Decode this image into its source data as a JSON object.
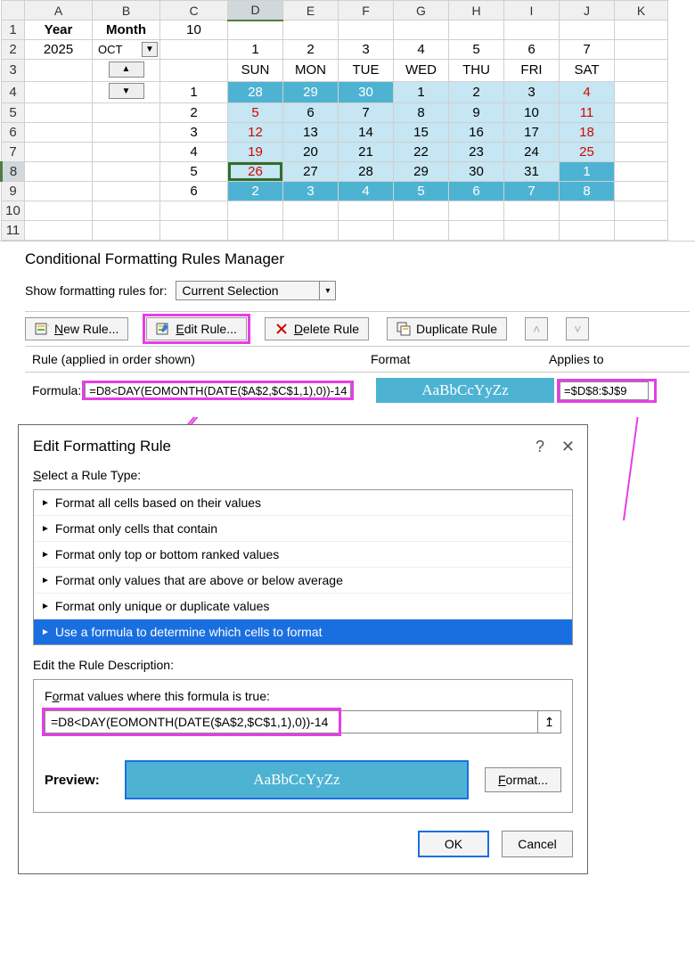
{
  "sheet": {
    "cols": [
      "A",
      "B",
      "C",
      "D",
      "E",
      "F",
      "G",
      "H",
      "I",
      "J",
      "K"
    ],
    "headers": {
      "year": "Year",
      "month": "Month"
    },
    "year_value": "2025",
    "month_value": "OCT",
    "c1_value": "10",
    "day_nums": [
      "1",
      "2",
      "3",
      "4",
      "5",
      "6",
      "7"
    ],
    "day_names": [
      "SUN",
      "MON",
      "TUE",
      "WED",
      "THU",
      "FRI",
      "SAT"
    ],
    "weeks": [
      {
        "n": "1",
        "cells": [
          {
            "v": "28",
            "c": "dark"
          },
          {
            "v": "29",
            "c": "dark"
          },
          {
            "v": "30",
            "c": "dark"
          },
          {
            "v": "1",
            "c": "light"
          },
          {
            "v": "2",
            "c": "light"
          },
          {
            "v": "3",
            "c": "light"
          },
          {
            "v": "4",
            "c": "light",
            "red": true
          }
        ]
      },
      {
        "n": "2",
        "cells": [
          {
            "v": "5",
            "c": "light",
            "red": true
          },
          {
            "v": "6",
            "c": "light"
          },
          {
            "v": "7",
            "c": "light"
          },
          {
            "v": "8",
            "c": "light"
          },
          {
            "v": "9",
            "c": "light"
          },
          {
            "v": "10",
            "c": "light"
          },
          {
            "v": "11",
            "c": "light",
            "red": true
          }
        ]
      },
      {
        "n": "3",
        "cells": [
          {
            "v": "12",
            "c": "light",
            "red": true
          },
          {
            "v": "13",
            "c": "light"
          },
          {
            "v": "14",
            "c": "light"
          },
          {
            "v": "15",
            "c": "light"
          },
          {
            "v": "16",
            "c": "light"
          },
          {
            "v": "17",
            "c": "light"
          },
          {
            "v": "18",
            "c": "light",
            "red": true
          }
        ]
      },
      {
        "n": "4",
        "cells": [
          {
            "v": "19",
            "c": "light",
            "red": true
          },
          {
            "v": "20",
            "c": "light"
          },
          {
            "v": "21",
            "c": "light"
          },
          {
            "v": "22",
            "c": "light"
          },
          {
            "v": "23",
            "c": "light"
          },
          {
            "v": "24",
            "c": "light"
          },
          {
            "v": "25",
            "c": "light",
            "red": true
          }
        ]
      },
      {
        "n": "5",
        "cells": [
          {
            "v": "26",
            "c": "light",
            "red": true,
            "active": true
          },
          {
            "v": "27",
            "c": "light"
          },
          {
            "v": "28",
            "c": "light"
          },
          {
            "v": "29",
            "c": "light"
          },
          {
            "v": "30",
            "c": "light"
          },
          {
            "v": "31",
            "c": "light"
          },
          {
            "v": "1",
            "c": "dark"
          }
        ]
      },
      {
        "n": "6",
        "cells": [
          {
            "v": "2",
            "c": "dark"
          },
          {
            "v": "3",
            "c": "dark"
          },
          {
            "v": "4",
            "c": "dark"
          },
          {
            "v": "5",
            "c": "dark"
          },
          {
            "v": "6",
            "c": "dark"
          },
          {
            "v": "7",
            "c": "dark"
          },
          {
            "v": "8",
            "c": "dark"
          }
        ]
      }
    ]
  },
  "manager": {
    "title": "Conditional Formatting Rules Manager",
    "show_for_label": "Show formatting rules for:",
    "show_for_value": "Current Selection",
    "buttons": {
      "new": "New Rule...",
      "edit": "Edit Rule...",
      "delete": "Delete Rule",
      "duplicate": "Duplicate Rule"
    },
    "cols": {
      "rule": "Rule (applied in order shown)",
      "format": "Format",
      "applies": "Applies to"
    },
    "row": {
      "label": "Formula:",
      "formula": "=D8<DAY(EOMONTH(DATE($A$2,$C$1,1),0))-14",
      "preview": "AaBbCcYyZz",
      "applies": "=$D$8:$J$9"
    }
  },
  "dialog": {
    "title": "Edit Formatting Rule",
    "select_label": "Select a Rule Type:",
    "types": [
      "Format all cells based on their values",
      "Format only cells that contain",
      "Format only top or bottom ranked values",
      "Format only values that are above or below average",
      "Format only unique or duplicate values",
      "Use a formula to determine which cells to format"
    ],
    "selected_type_index": 5,
    "desc_label": "Edit the Rule Description:",
    "formula_label": "Format values where this formula is true:",
    "formula": "=D8<DAY(EOMONTH(DATE($A$2,$C$1,1),0))-14",
    "preview_label": "Preview:",
    "preview_text": "AaBbCcYyZz",
    "format_btn": "Format...",
    "ok": "OK",
    "cancel": "Cancel"
  }
}
